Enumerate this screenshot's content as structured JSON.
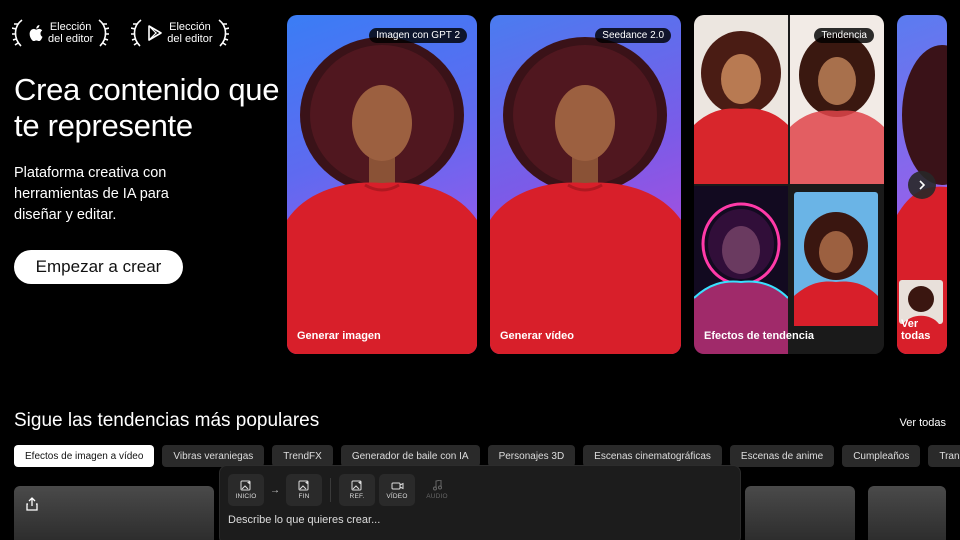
{
  "awards": [
    {
      "line1": "Elección",
      "line2": "del editor",
      "logo": "apple-logo"
    },
    {
      "line1": "Elección",
      "line2": "del editor",
      "logo": "google-play-logo"
    }
  ],
  "hero": {
    "title": "Crea contenido que te represente",
    "subtitle": "Plataforma creativa con herramientas de IA para diseñar y editar.",
    "cta": "Empezar a crear"
  },
  "cards": [
    {
      "badge": "Imagen con GPT 2",
      "label": "Generar imagen"
    },
    {
      "badge": "Seedance 2.0",
      "label": "Generar vídeo"
    },
    {
      "badge": "Tendencia",
      "label": "Efectos de tendencia"
    },
    {
      "badge": "",
      "label": "Ver todas"
    }
  ],
  "section": {
    "title": "Sigue las tendencias más populares",
    "see_all": "Ver todas"
  },
  "chips": [
    "Efectos de imagen a vídeo",
    "Vibras veraniegas",
    "TrendFX",
    "Generador de baile con IA",
    "Personajes 3D",
    "Escenas cinematográficas",
    "Escenas de anime",
    "Cumpleaños",
    "Transi"
  ],
  "panel": {
    "tools": [
      "INICIO",
      "FIN",
      "REF.",
      "VÍDEO",
      "AUDIO"
    ],
    "placeholder": "Describe lo que quieres crear..."
  },
  "colors": {
    "background": "#000000",
    "chip_bg": "#2a2a2a",
    "accent_pink": "#d043d6",
    "accent_blue": "#3a7df5",
    "shirt_red": "#d81f2a"
  }
}
